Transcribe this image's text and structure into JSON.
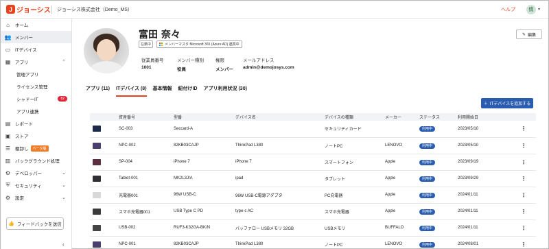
{
  "topbar": {
    "logo_text": "ジョーシス",
    "company": "ジョーシス株式会社（Demo_MS）",
    "help": "ヘルプ",
    "user_initial": "情"
  },
  "sidebar": {
    "items": [
      {
        "label": "ホーム",
        "icon": "home-icon",
        "glyph": "⌂",
        "active": false
      },
      {
        "label": "メンバー",
        "icon": "members-icon",
        "glyph": "👥",
        "active": true
      },
      {
        "label": "ITデバイス",
        "icon": "device-icon",
        "glyph": "▭",
        "active": false
      },
      {
        "label": "アプリ",
        "icon": "apps-icon",
        "glyph": "▦",
        "active": false
      }
    ],
    "app_sub": [
      "管理アプリ",
      "ライセンス管理",
      "シャドーIT",
      "アプリ連携"
    ],
    "shadow_count": "82",
    "items2": [
      {
        "label": "レポート",
        "icon": "report-icon",
        "glyph": "▤"
      },
      {
        "label": "ストア",
        "icon": "store-icon",
        "glyph": "▣"
      },
      {
        "label": "棚卸し",
        "icon": "inventory-icon",
        "glyph": "☰",
        "beta": "ベータ版"
      },
      {
        "label": "バックグラウンド処理",
        "icon": "background-icon",
        "glyph": "▥"
      },
      {
        "label": "デベロッパー",
        "icon": "developer-icon",
        "glyph": "⚙",
        "chev": true
      },
      {
        "label": "セキュリティ",
        "icon": "security-icon",
        "glyph": "⛨",
        "chev": true
      },
      {
        "label": "設定",
        "icon": "settings-icon",
        "glyph": "⚙",
        "chev": true
      }
    ],
    "feedback": "フィードバックを送信"
  },
  "profile": {
    "name": "富田 奈々",
    "status": "在籍中",
    "link": "メンバーマスタ Microsoft 365 (Azure AD) 連携中",
    "labels": [
      "従業員番号",
      "メンバー種別",
      "権限",
      "メールアドレス"
    ],
    "values": [
      "1001",
      "役員",
      "メンバー",
      "admin@demojosys.com"
    ],
    "edit": "編集"
  },
  "tabs": [
    "アプリ (11)",
    "ITデバイス (8)",
    "基本情報",
    "紐付けID",
    "アプリ利用状況 (30)"
  ],
  "tab_active": 1,
  "add_button": "ITデバイスを追加する",
  "table": {
    "headers": [
      "",
      "資産番号",
      "型番",
      "デバイス名",
      "デバイスの種類",
      "メーカー",
      "ステータス",
      "利用開始日",
      ""
    ],
    "rows": [
      {
        "thumb": "#1b2a4a",
        "asset": "SC-003",
        "model": "Seccard-A",
        "name": "",
        "type": "セキュリティカード",
        "maker": "",
        "status": "利用中",
        "date": "2023/05/10"
      },
      {
        "thumb": "#4a3f6e",
        "asset": "NPC-002",
        "model": "82KB03CAJP",
        "name": "ThinkPad L380",
        "type": "ノートPC",
        "maker": "LENOVO",
        "status": "利用中",
        "date": "2023/05/10"
      },
      {
        "thumb": "#5a2e3e",
        "asset": "SP-004",
        "model": "iPhone 7",
        "name": "iPhone 7",
        "type": "スマートフォン",
        "maker": "Apple",
        "status": "利用中",
        "date": "2023/09/19"
      },
      {
        "thumb": "#2e2e34",
        "asset": "Tablet-001",
        "model": "MK2L3J/A",
        "name": "ipad",
        "type": "タブレット",
        "maker": "Apple",
        "status": "利用中",
        "date": "2023/09/29"
      },
      {
        "thumb": "#d8d8d8",
        "asset": "充電器001",
        "model": "96W USB-C",
        "name": "96W USB-C電源アダプタ",
        "type": "PC充電器",
        "maker": "Apple",
        "status": "利用中",
        "date": "2024/01/11"
      },
      {
        "thumb": "#3a3a3a",
        "asset": "スマホ充電器001",
        "model": "USB Type C PD",
        "name": "type-c AC",
        "type": "スマホ充電器",
        "maker": "Apple",
        "status": "利用中",
        "date": "2024/01/11"
      },
      {
        "thumb": "#444444",
        "asset": "USB-002",
        "model": "RUF3-K32GA-BK/N",
        "name": "バッファロー USBメモリ 32GB",
        "type": "USBメモリ",
        "maker": "BUFFALO",
        "status": "利用中",
        "date": "2024/01/11"
      },
      {
        "thumb": "#4a3f6e",
        "asset": "NPC-001",
        "model": "82KB03CAJP",
        "name": "ThinkPad L380",
        "type": "ノートPC",
        "maker": "LENOVO",
        "status": "利用中",
        "date": "2024/08/01"
      }
    ]
  },
  "colors": {
    "accent": "#e8421c",
    "primary": "#2a5db0",
    "danger": "#e0243a"
  }
}
